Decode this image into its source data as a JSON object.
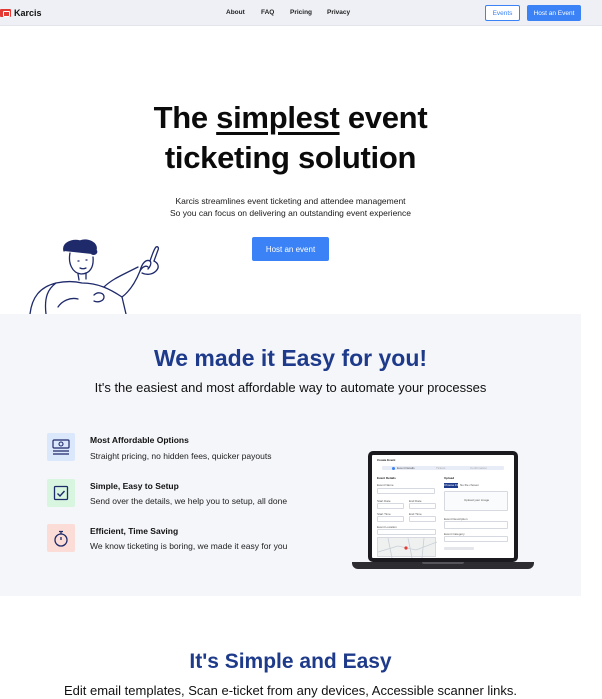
{
  "nav": {
    "brand": "Karcis",
    "links": [
      "About",
      "FAQ",
      "Pricing",
      "Privacy"
    ],
    "events_button": "Events",
    "host_button": "Host an Event"
  },
  "hero": {
    "title_before": "The ",
    "title_emphasis": "simplest",
    "title_after": " event",
    "title_line2": "ticketing solution",
    "subtitle_1": "Karcis streamlines event ticketing and attendee management",
    "subtitle_2": "So you can focus on delivering an outstanding event experience",
    "cta": "Host an event"
  },
  "easy": {
    "title": "We made it Easy for you!",
    "subtitle": "It's the easiest and most affordable way to automate your processes",
    "features": [
      {
        "title": "Most Affordable Options",
        "desc": "Straight pricing, no hidden fees, quicker payouts",
        "icon": "money-icon",
        "color": "#dbe7fb"
      },
      {
        "title": "Simple, Easy to Setup",
        "desc": "Send over the details, we help you to setup, all done",
        "icon": "checkbox-icon",
        "color": "#d7f5df"
      },
      {
        "title": "Efficient, Time Saving",
        "desc": "We know ticketing is boring, we made it easy for you",
        "icon": "stopwatch-icon",
        "color": "#fbdcd6"
      }
    ],
    "laptop_screen": {
      "header": "Create Event",
      "steps": [
        "Event Details",
        "Tickets",
        "Confirmation"
      ],
      "section": "Event Details",
      "fields": [
        "Event Name",
        "Start Date",
        "End Date",
        "Start Time",
        "End Time",
        "Event Location"
      ],
      "tabs": [
        "Choose File",
        "No file chosen"
      ],
      "side_labels": [
        "Upload your image",
        "Event Description",
        "Event Category"
      ]
    }
  },
  "simple": {
    "title": "It's Simple and Easy",
    "subtitle": "Edit email templates, Scan e-ticket from any devices, Accessible scanner links."
  }
}
